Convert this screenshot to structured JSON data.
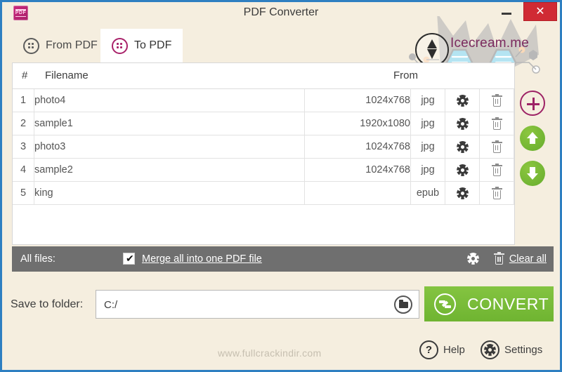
{
  "window": {
    "title": "PDF Converter",
    "app_icon": "pdf-converter-icon",
    "minimize_label": "–",
    "close_label": "✕",
    "border_color": "#2e7fc1",
    "chrome_bg": "#f5eedf"
  },
  "branding": {
    "logo_text": "Icecream.me",
    "logo_icon": "ice-cream-cone-icon",
    "logo_color": "#7b2a5e"
  },
  "tabs": [
    {
      "id": "from-pdf",
      "label": "From PDF",
      "icon": "from-pdf-icon",
      "active": false
    },
    {
      "id": "to-pdf",
      "label": "To PDF",
      "icon": "to-pdf-icon",
      "active": true
    }
  ],
  "table": {
    "columns": {
      "number": "#",
      "filename": "Filename",
      "size": "",
      "from": "From",
      "settings": "",
      "delete": ""
    },
    "rows": [
      {
        "num": "1",
        "filename": "photo4",
        "size": "1024x768",
        "type": "jpg",
        "settings_icon": "gear-icon",
        "delete_icon": "trash-icon"
      },
      {
        "num": "2",
        "filename": "sample1",
        "size": "1920x1080",
        "type": "jpg",
        "settings_icon": "gear-icon",
        "delete_icon": "trash-icon"
      },
      {
        "num": "3",
        "filename": "photo3",
        "size": "1024x768",
        "type": "jpg",
        "settings_icon": "gear-icon",
        "delete_icon": "trash-icon"
      },
      {
        "num": "4",
        "filename": "sample2",
        "size": "1024x768",
        "type": "jpg",
        "settings_icon": "gear-icon",
        "delete_icon": "trash-icon"
      },
      {
        "num": "5",
        "filename": "king",
        "size": "",
        "type": "epub",
        "settings_icon": "gear-icon",
        "delete_icon": "trash-icon"
      }
    ]
  },
  "side_actions": [
    {
      "id": "add",
      "icon": "plus-circle-icon",
      "color": "#9d2265"
    },
    {
      "id": "move-up",
      "icon": "arrow-up-icon",
      "color": "#7bbb35"
    },
    {
      "id": "move-down",
      "icon": "arrow-down-icon",
      "color": "#7bbb35"
    }
  ],
  "all_files_bar": {
    "label": "All files:",
    "merge_checked": true,
    "merge_label": "Merge all into one PDF file",
    "settings_icon": "gear-icon",
    "delete_icon": "trash-icon",
    "clear_all_label": "Clear all",
    "bg_color": "#6f6f6f"
  },
  "save_row": {
    "label": "Save to folder:",
    "path_value": "C:/",
    "path_placeholder": "C:/",
    "browse_icon": "folder-icon",
    "convert_label": "CONVERT",
    "convert_icon": "convert-refresh-icon",
    "convert_color": "#7bbb35"
  },
  "footer": {
    "watermark": "www.fullcrackindir.com",
    "help_label": "Help",
    "help_icon": "question-circle-icon",
    "settings_label": "Settings",
    "settings_icon": "gear-circle-icon"
  }
}
